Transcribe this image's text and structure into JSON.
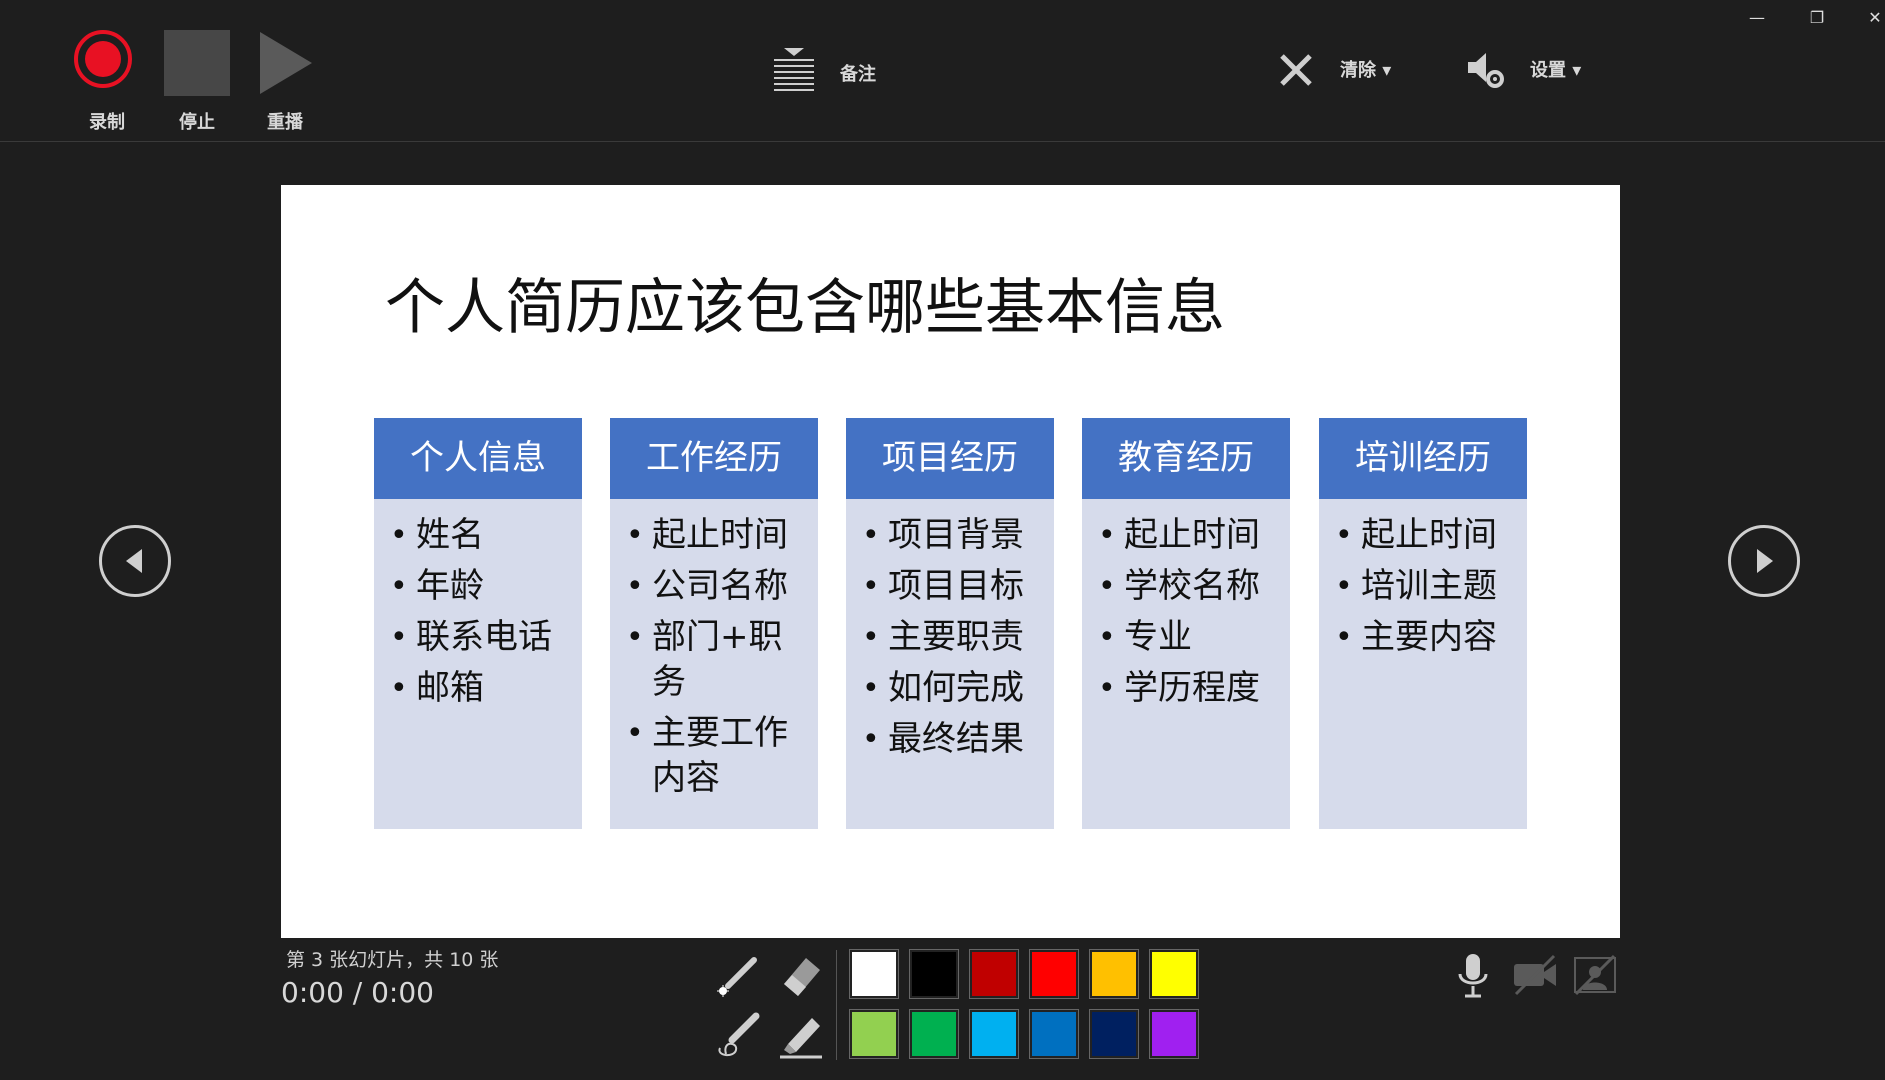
{
  "toolbar": {
    "record_label": "录制",
    "stop_label": "停止",
    "replay_label": "重播",
    "notes_label": "备注",
    "clear_label": "清除 ▾",
    "settings_label": "设置 ▾"
  },
  "window": {
    "minimize_glyph": "—",
    "restore_glyph": "❐",
    "close_glyph": "✕"
  },
  "slide": {
    "title": "个人简历应该包含哪些基本信息",
    "columns": [
      {
        "header": "个人信息",
        "items": [
          "姓名",
          "年龄",
          "联系电话",
          "邮箱"
        ]
      },
      {
        "header": "工作经历",
        "items": [
          "起止时间",
          "公司名称",
          "部门+职务",
          "主要工作内容"
        ]
      },
      {
        "header": "项目经历",
        "items": [
          "项目背景",
          "项目目标",
          "主要职责",
          "如何完成",
          "最终结果"
        ]
      },
      {
        "header": "教育经历",
        "items": [
          "起止时间",
          "学校名称",
          "专业",
          "学历程度"
        ]
      },
      {
        "header": "培训经历",
        "items": [
          "起止时间",
          "培训主题",
          "主要内容"
        ]
      }
    ]
  },
  "status": {
    "slide_count": "第 3 张幻灯片，共 10 张",
    "timer": "0:00 / 0:00"
  },
  "colors": {
    "accent_record": "#e81123",
    "column_header": "#4472c4",
    "column_body": "#d6dbeb",
    "swatches": [
      "#ffffff",
      "#000000",
      "#c00000",
      "#ff0000",
      "#ffc000",
      "#ffff00",
      "#92d050",
      "#00b050",
      "#00b0f0",
      "#0070c0",
      "#002060",
      "#a020f0"
    ]
  },
  "icons": [
    "record-icon",
    "stop-icon",
    "play-icon",
    "notes-icon",
    "clear-x-icon",
    "audio-settings-icon",
    "laser-pointer-icon",
    "eraser-icon",
    "pen-icon",
    "highlighter-icon",
    "microphone-icon",
    "camera-off-icon",
    "camera-preview-off-icon",
    "previous-slide-icon",
    "next-slide-icon"
  ]
}
